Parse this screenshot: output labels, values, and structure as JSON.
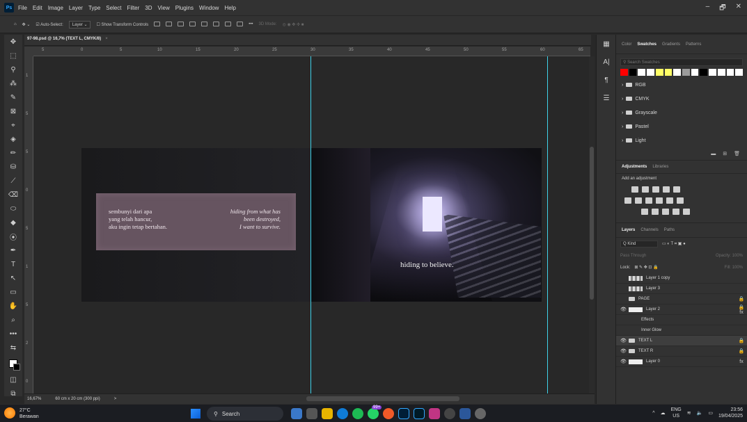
{
  "menubar": {
    "logo": "Ps",
    "items": [
      "File",
      "Edit",
      "Image",
      "Layer",
      "Type",
      "Select",
      "Filter",
      "3D",
      "View",
      "Plugins",
      "Window",
      "Help"
    ],
    "win_controls": [
      "–",
      "🗗",
      "✕"
    ]
  },
  "options": {
    "auto_select": "Auto-Select:",
    "layer_select": "Layer",
    "transform": "Show Transform Controls",
    "more": "•••",
    "mode3d": "3D Mode:"
  },
  "tools": [
    "✥",
    "⬚",
    "⚲",
    "⁂",
    "✎",
    "⊠",
    "⌖",
    "◈",
    "✏",
    "⛁",
    "⟋",
    "⌫",
    "⬭",
    "◆",
    "⦿",
    "✒",
    "T",
    "↖",
    "▭",
    "✋",
    "⌕",
    "•••"
  ],
  "document": {
    "tab": "97-98.psd @ 16,7% (TEXT L, CMYK/8)",
    "tab_close": "×",
    "text_indo": [
      "sembunyi dari apa",
      "yang telah hancur,",
      "aku ingin tetap bertahan."
    ],
    "text_en": [
      "hiding from what has",
      "been destroyed,",
      "I want to survive."
    ],
    "caption": "hiding to believe."
  },
  "ruler": {
    "h": [
      "5",
      "0",
      "5",
      "10",
      "15",
      "20",
      "25",
      "30",
      "35",
      "40",
      "45",
      "50",
      "55",
      "60",
      "65"
    ],
    "v": [
      "1",
      "5",
      "5",
      "0",
      "5",
      "1",
      "5",
      "2",
      "0",
      "2",
      "5",
      "3",
      "0"
    ]
  },
  "status": {
    "zoom": "16,67%",
    "size": "60 cm x 20 cm (300 ppi)",
    "arrow": ">"
  },
  "panels": {
    "color_tabs": [
      "Color",
      "Swatches",
      "Gradients",
      "Patterns"
    ],
    "search_swatches": "Search Swatches",
    "swatch_colors": [
      "#ff0000",
      "#000000",
      "#ffffff",
      "#ffffff",
      "#ffff66",
      "#ffff66",
      "#ffffff",
      "#9b9b9b",
      "#ffffff",
      "#000000",
      "#ffffff",
      "#ffffff",
      "#ffffff",
      "#ffffff"
    ],
    "folders": [
      "RGB",
      "CMYK",
      "Grayscale",
      "Pastel",
      "Light"
    ],
    "adj_tabs": [
      "Adjustments",
      "Libraries"
    ],
    "add_adjustment": "Add an adjustment",
    "layer_tabs": [
      "Layers",
      "Channels",
      "Paths"
    ],
    "kind": "Q Kind",
    "blend": "Pass Through",
    "opacity": "Opacity: 100%",
    "lock": "Lock:",
    "fill": "Fill: 100%",
    "layers": [
      {
        "name": "Layer 1 copy",
        "visible": false,
        "thumb": "checker",
        "lock": "",
        "selected": false
      },
      {
        "name": "Layer 3",
        "visible": false,
        "thumb": "checker",
        "lock": "",
        "selected": false
      },
      {
        "name": "PAGE",
        "visible": false,
        "thumb": "folder",
        "lock": "🔒",
        "selected": false
      },
      {
        "name": "Layer 2",
        "visible": true,
        "thumb": "white",
        "lock": "🔒 fx",
        "selected": false
      },
      {
        "name": "Effects",
        "visible": true,
        "thumb": "none",
        "lock": "",
        "selected": false,
        "sub": true
      },
      {
        "name": "Inner Glow",
        "visible": true,
        "thumb": "none",
        "lock": "",
        "selected": false,
        "sub": true
      },
      {
        "name": "TEXT L",
        "visible": true,
        "thumb": "folder",
        "lock": "🔒",
        "selected": true
      },
      {
        "name": "TEXT R",
        "visible": true,
        "thumb": "folder",
        "lock": "🔒",
        "selected": false
      },
      {
        "name": "Layer 0",
        "visible": true,
        "thumb": "white",
        "lock": "fx",
        "selected": false
      }
    ]
  },
  "taskbar": {
    "temp": "27°C",
    "weather": "Berawan",
    "search": "Search",
    "lang": "ENG",
    "region": "US",
    "time": "23:56",
    "date": "19/04/2025",
    "badge": "99+"
  }
}
